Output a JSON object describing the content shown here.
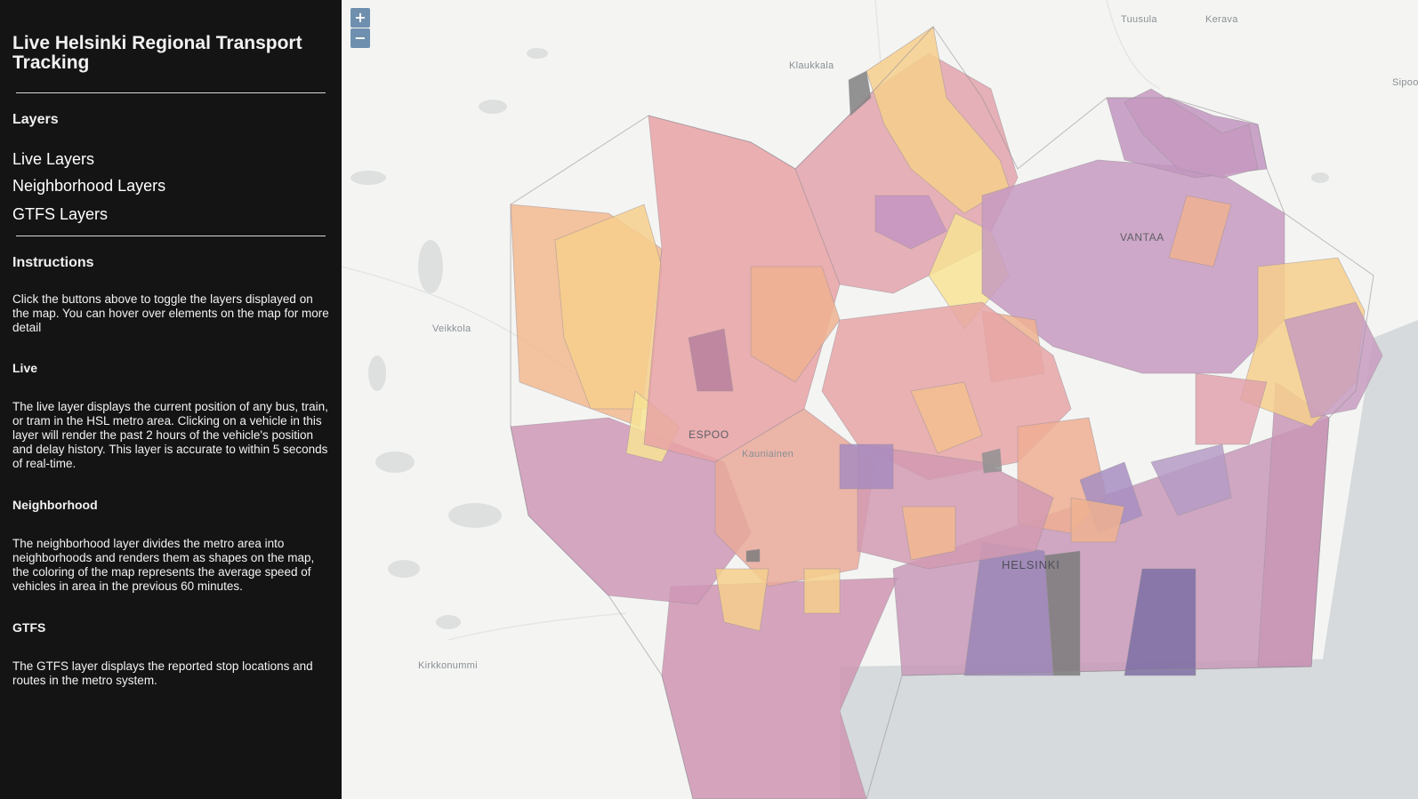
{
  "sidebar": {
    "title": "Live Helsinki Regional Transport Tracking",
    "layers_heading": "Layers",
    "layer_buttons": [
      "Live Layers",
      "Neighborhood Layers",
      "GTFS Layers"
    ],
    "instructions_heading": "Instructions",
    "instructions_text": "Click the buttons above to toggle the layers displayed on the map. You can hover over elements on the map for more detail",
    "live_heading": "Live",
    "live_text": "The live layer displays the current position of any bus, train, or tram in the HSL metro area. Clicking on a vehicle in this layer will render the past 2 hours of the vehicle's position and delay history. This layer is accurate to within 5 seconds of real-time.",
    "neighborhood_heading": "Neighborhood",
    "neighborhood_text": "The neighborhood layer divides the metro area into neighborhoods and renders them as shapes on the map, the coloring of the map represents the average speed of vehicles in area in the previous 60 minutes.",
    "gtfs_heading": "GTFS",
    "gtfs_text": "The GTFS layer displays the reported stop locations and routes in the metro system."
  },
  "map": {
    "zoom_in": "+",
    "zoom_out": "−",
    "place_labels": [
      "Tuusula",
      "Kerava",
      "Klaukkala",
      "Sipoo",
      "Veikkola",
      "Kauniainen",
      "Kirkkonummi"
    ],
    "city_labels": [
      "VANTAA",
      "ESPOO",
      "HELSINKI"
    ],
    "colors": {
      "sidebar_bg": "#141414",
      "land": "#f4f5f3",
      "water": "#d6dadd",
      "zoom_button": "#6f8fae",
      "choropleth_scale": [
        "#8f7ab8",
        "#c195c0",
        "#dd9aa6",
        "#eda79a",
        "#f5c08a",
        "#f8dc8c",
        "#909090"
      ]
    }
  }
}
